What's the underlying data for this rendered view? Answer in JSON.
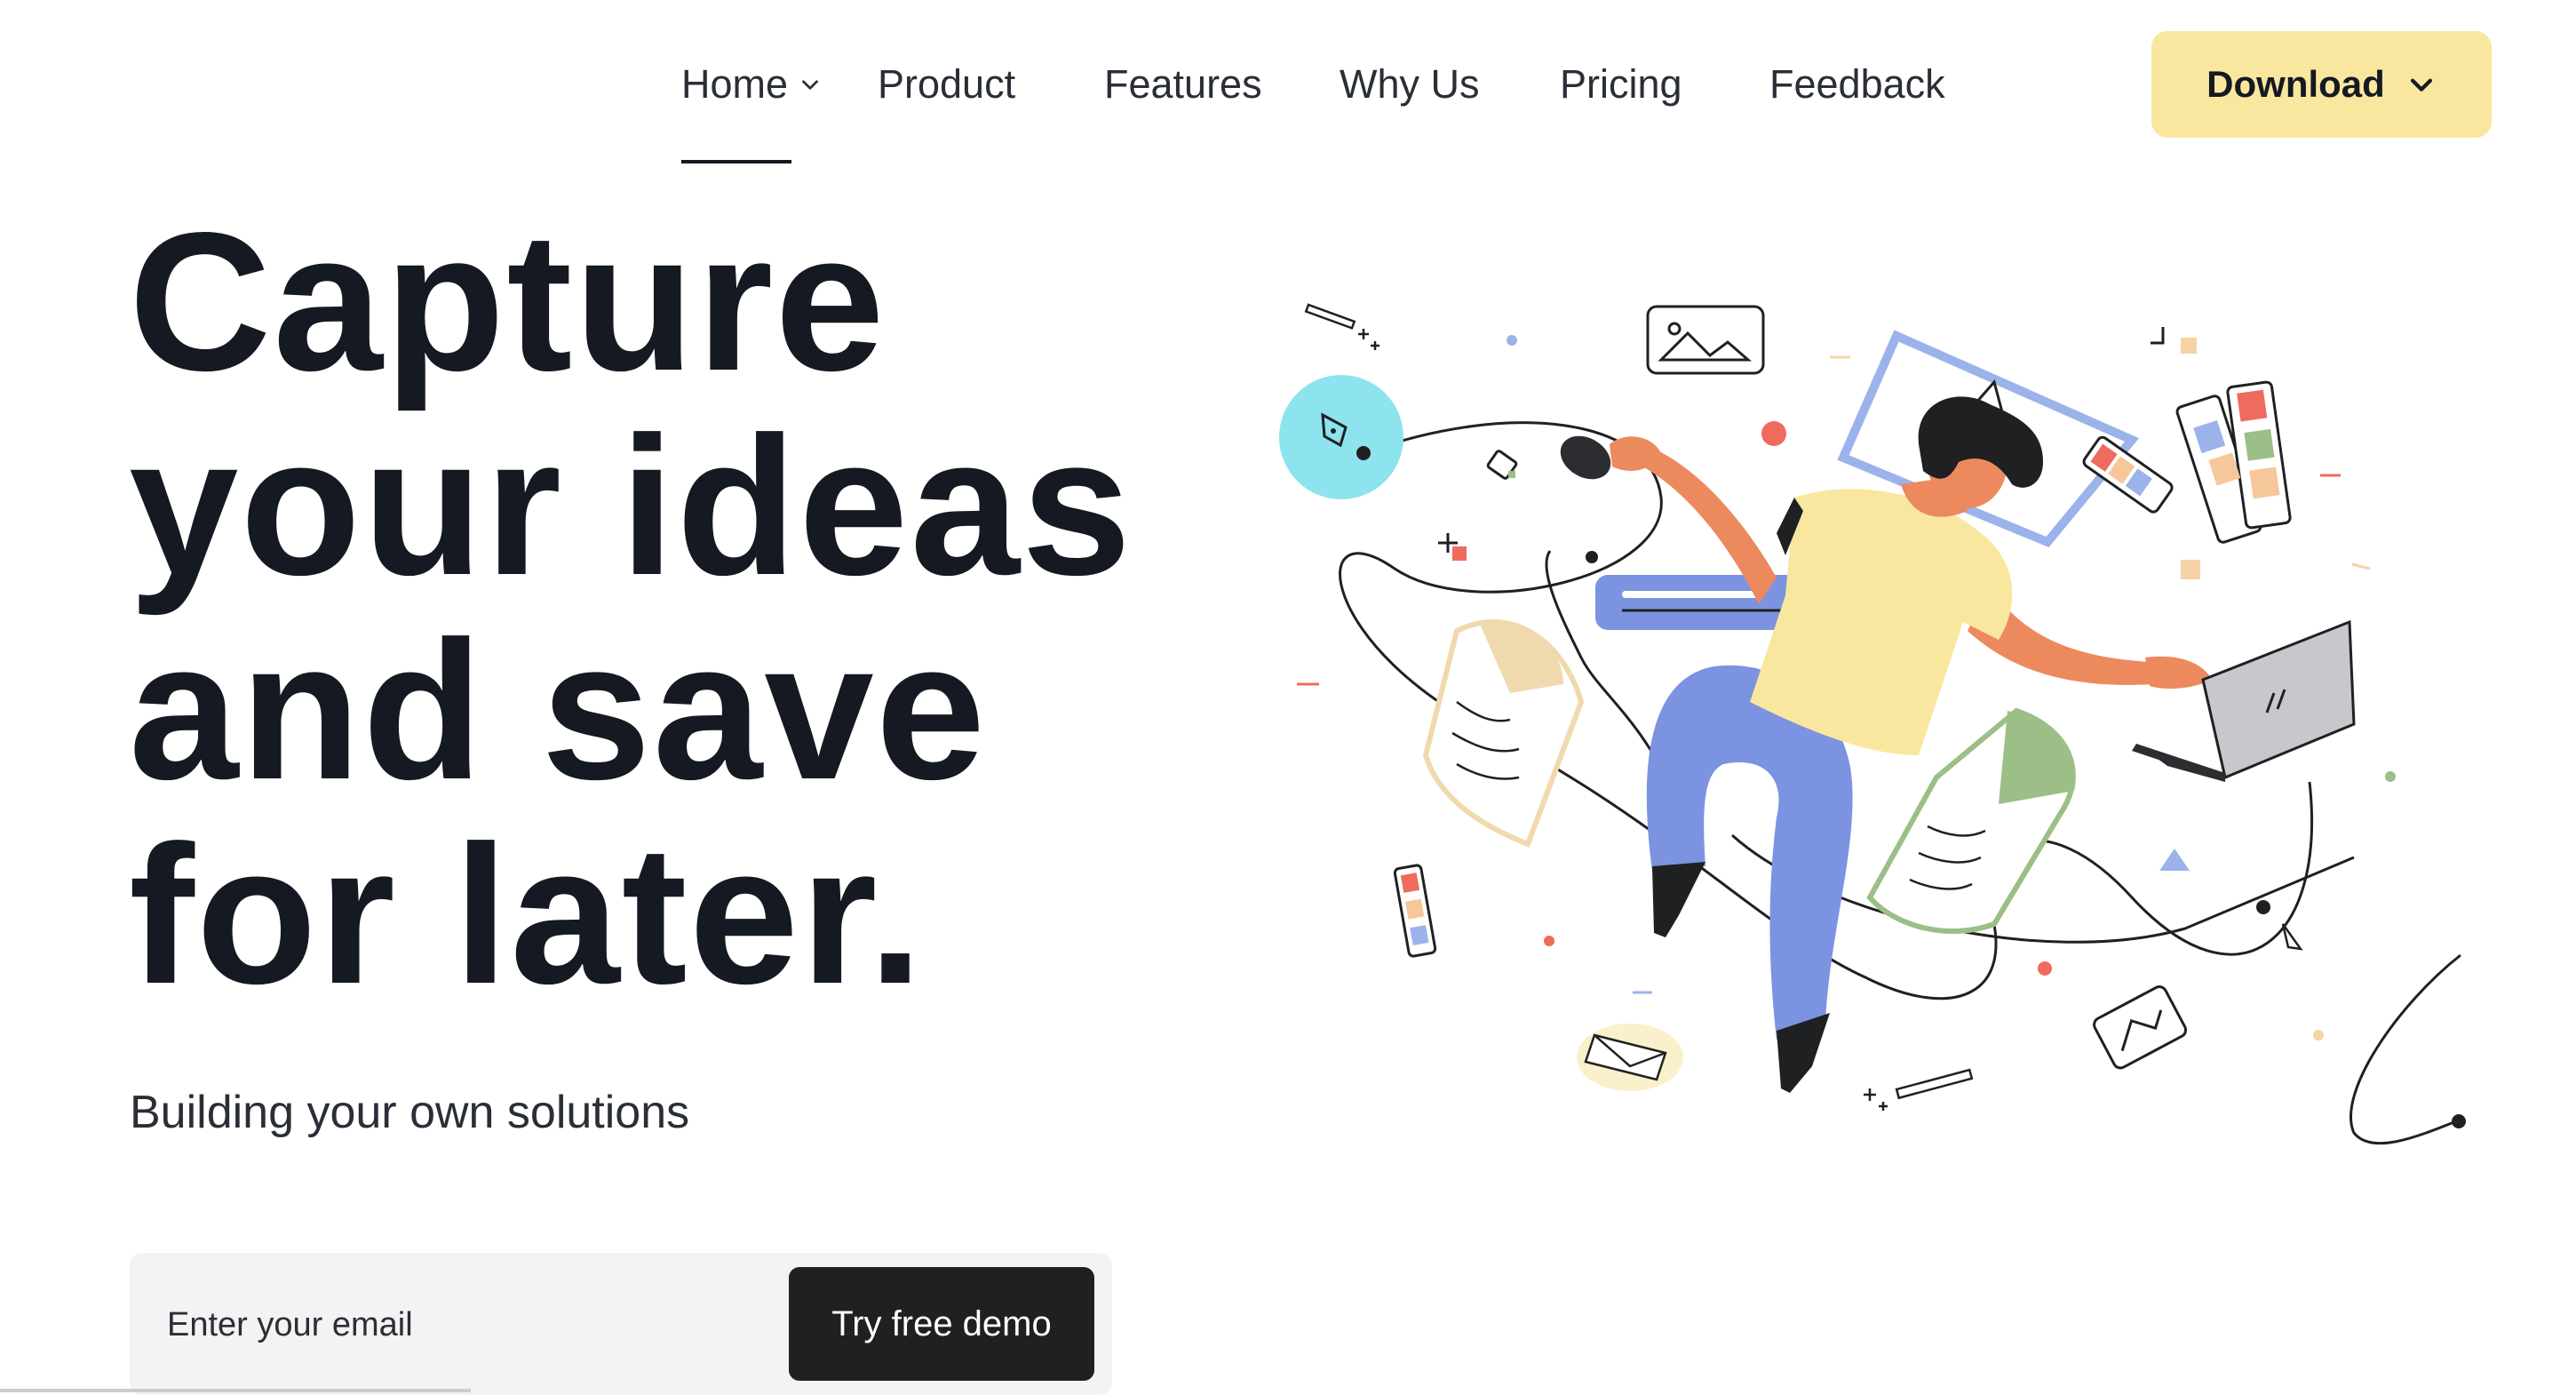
{
  "nav": {
    "items": [
      {
        "label": "Home",
        "active": true,
        "has_dropdown": true
      },
      {
        "label": "Product"
      },
      {
        "label": "Features"
      },
      {
        "label": "Why Us"
      },
      {
        "label": "Pricing"
      },
      {
        "label": "Feedback"
      }
    ],
    "download_label": "Download"
  },
  "hero": {
    "title_lines": [
      "Capture",
      "your ideas",
      "and save",
      "for later."
    ],
    "subtitle": "Building your own solutions"
  },
  "form": {
    "email_placeholder": "Enter your email",
    "email_value": "",
    "submit_label": "Try free demo"
  },
  "colors": {
    "accent_yellow": "#f9e79f",
    "text_dark": "#151922",
    "button_dark": "#1f2022",
    "illustration_blue": "#7b93e0",
    "illustration_cyan": "#8de3ee",
    "illustration_skin": "#ec8a5e",
    "illustration_shirt": "#f9e79f",
    "illustration_green": "#9bbf86",
    "illustration_red": "#ee6b5e"
  },
  "icons": [
    "chevron-down-icon",
    "pen-tool-icon",
    "image-frame-icon",
    "laptop-icon",
    "envelope-icon",
    "cursor-arrow-icon",
    "color-swatch-icon"
  ]
}
